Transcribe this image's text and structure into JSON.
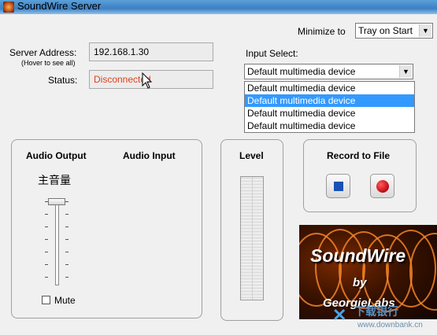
{
  "window": {
    "title": "SoundWire Server"
  },
  "minimize": {
    "label": "Minimize to",
    "value": "Tray on Start"
  },
  "server": {
    "address_label": "Server Address:",
    "address_hint": "(Hover to see all)",
    "address_value": "192.168.1.30",
    "status_label": "Status:",
    "status_value": "Disconnected",
    "status_color": "#e0401c"
  },
  "input_select": {
    "label": "Input Select:",
    "value": "Default multimedia device",
    "options": [
      "Default multimedia device",
      "Default multimedia device",
      "Default multimedia device",
      "Default multimedia device"
    ],
    "highlighted_index": 1
  },
  "audio": {
    "output_title": "Audio Output",
    "input_title": "Audio Input",
    "master_volume_label": "主音量",
    "volume_level": 1.0,
    "mute_label": "Mute",
    "mute_checked": false
  },
  "level": {
    "title": "Level",
    "value": 0
  },
  "record": {
    "title": "Record to File",
    "stop_icon": "stop-icon",
    "record_icon": "record-icon"
  },
  "logo": {
    "title": "SoundWire",
    "by": "by",
    "company": "GeorgieLabs"
  },
  "watermark": {
    "text": "下载银行",
    "url": "www.downbank.cn"
  },
  "colors": {
    "selection": "#3399ff",
    "stop": "#1a4fb5",
    "record": "#c8141e"
  }
}
